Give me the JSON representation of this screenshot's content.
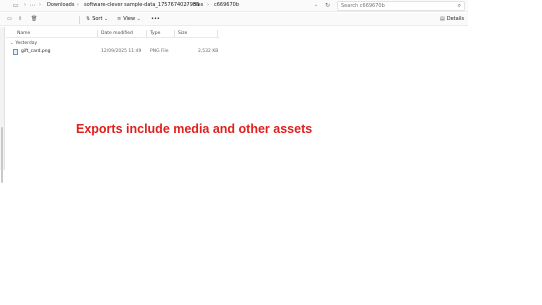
{
  "address_bar": {
    "breadcrumbs": [
      "Downloads",
      "software-clever sample-data_1757674027936",
      "files",
      "c669670b"
    ],
    "search_placeholder": "Search c669670b"
  },
  "command_bar": {
    "sort_label": "Sort",
    "view_label": "View",
    "more_label": "•••",
    "details_label": "Details"
  },
  "columns": {
    "name": "Name",
    "date_modified": "Date modified",
    "type": "Type",
    "size": "Size"
  },
  "group": {
    "label": "Yesterday"
  },
  "files": [
    {
      "name": "gift_card.png",
      "date_modified": "12/09/2025 11:49",
      "type": "PNG File",
      "size": "2,532 KB"
    }
  ],
  "caption": "Exports include media and other assets",
  "colors": {
    "caption": "#e0201c",
    "accent": "#0067c0"
  }
}
